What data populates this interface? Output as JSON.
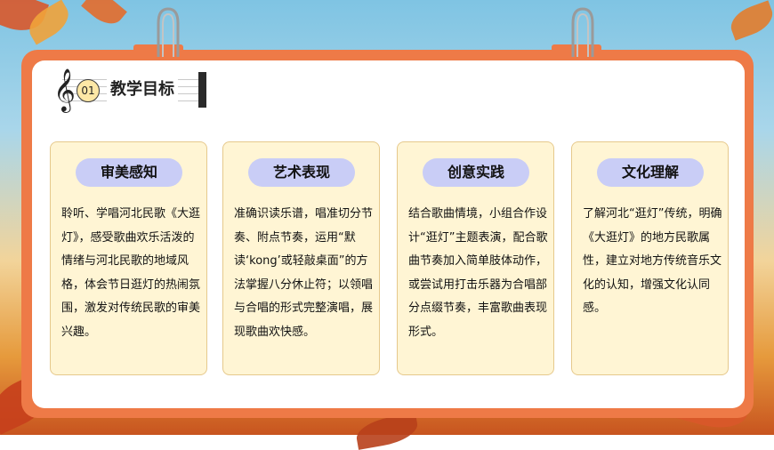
{
  "header": {
    "section_number": "01",
    "title": "教学目标"
  },
  "cards": [
    {
      "title": "审美感知",
      "body": "聆听、学唱河北民歌《大逛灯》，感受歌曲欢乐活泼的情绪与河北民歌的地域风格，体会节日逛灯的热闹氛围，激发对传统民歌的审美兴趣。"
    },
    {
      "title": "艺术表现",
      "body": "准确识读乐谱，唱准切分节奏、附点节奏，运用“默读‘kong’或轻敲桌面”的方法掌握八分休止符；以领唱与合唱的形式完整演唱，展现歌曲欢快感。"
    },
    {
      "title": "创意实践",
      "body": "结合歌曲情境，小组合作设计“逛灯”主题表演，配合歌曲节奏加入简单肢体动作，或尝试用打击乐器为合唱部分点缀节奏，丰富歌曲表现形式。"
    },
    {
      "title": "文化理解",
      "body": "了解河北“逛灯”传统，明确《大逛灯》的地方民歌属性，建立对地方传统音乐文化的认知，增强文化认同感。"
    }
  ],
  "colors": {
    "frame": "#ee7a47",
    "card_bg": "#fff5d4",
    "card_border": "#e6c98c",
    "pill": "#c9cdf6",
    "badge": "#fde7a6"
  },
  "icons": [
    "treble-clef-icon",
    "binder-clip-icon"
  ]
}
